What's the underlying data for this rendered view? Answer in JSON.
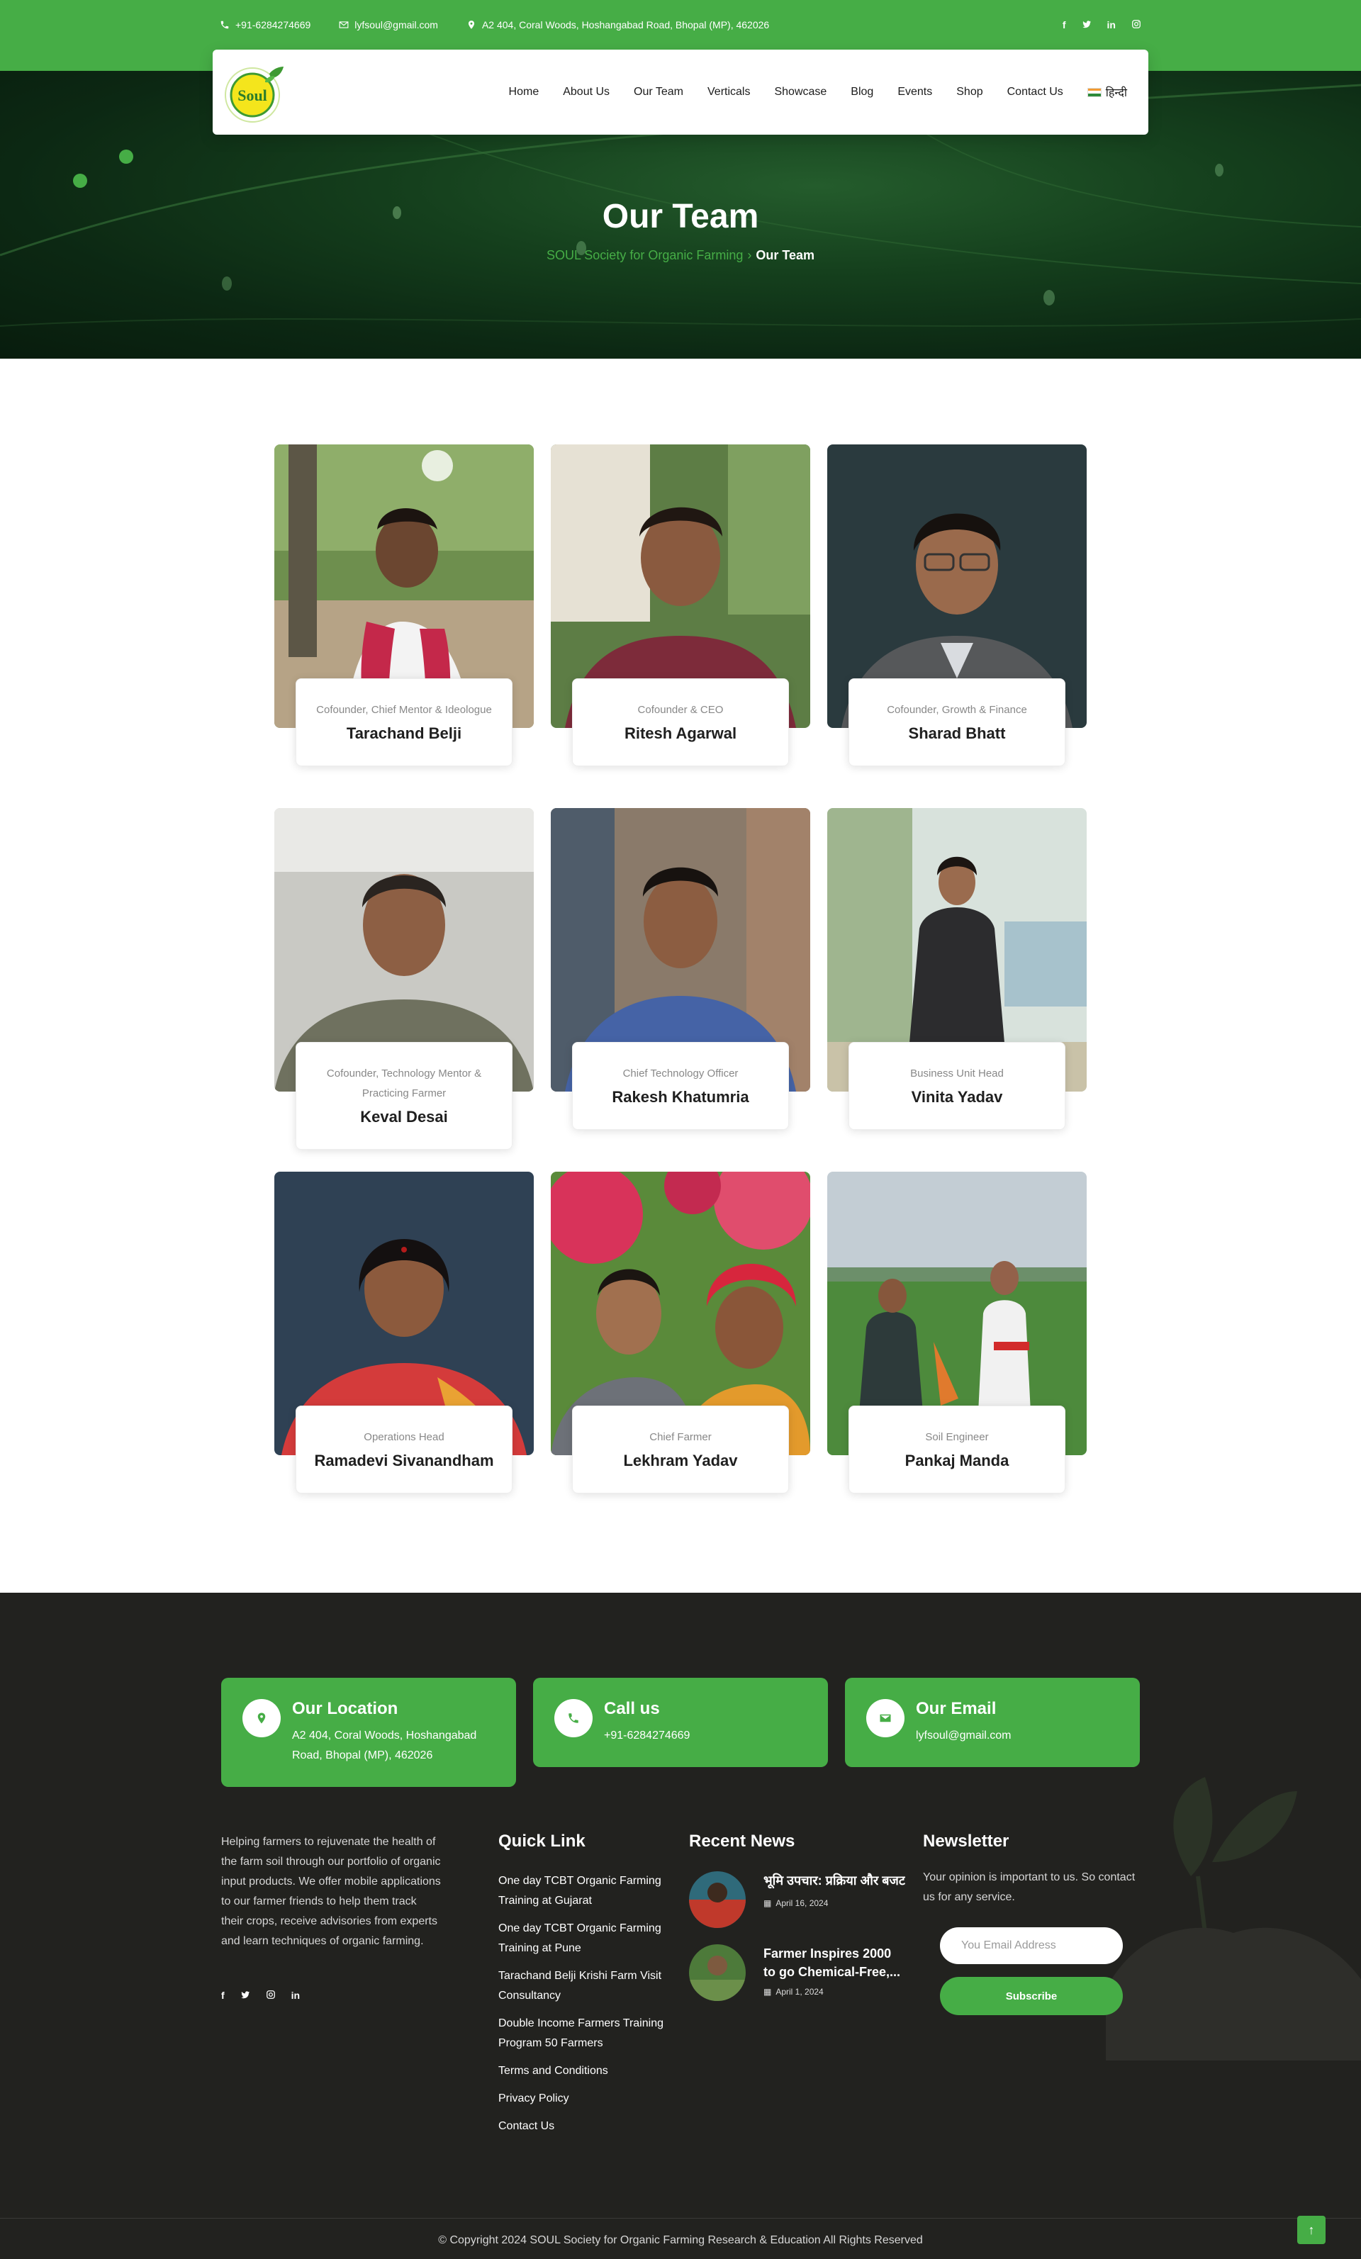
{
  "topbar": {
    "phone": "+91-6284274669",
    "email": "lyfsoul@gmail.com",
    "address": "A2 404, Coral Woods, Hoshangabad Road, Bhopal (MP), 462026",
    "socials": [
      "f",
      "t",
      "in",
      "ig"
    ]
  },
  "nav": {
    "logo_text": "Soul",
    "items": [
      "Home",
      "About Us",
      "Our Team",
      "Verticals",
      "Showcase",
      "Blog",
      "Events",
      "Shop",
      "Contact Us"
    ],
    "language": "हिन्दी"
  },
  "hero": {
    "title": "Our Team",
    "breadcrumb_home": "SOUL Society for Organic Farming",
    "breadcrumb_current": "Our Team"
  },
  "team": [
    {
      "role": "Cofounder, Chief Mentor & Ideologue",
      "name": "Tarachand Belji"
    },
    {
      "role": "Cofounder & CEO",
      "name": "Ritesh Agarwal"
    },
    {
      "role": "Cofounder, Growth & Finance",
      "name": "Sharad Bhatt"
    },
    {
      "role": "Cofounder, Technology Mentor & Practicing Farmer",
      "name": "Keval Desai"
    },
    {
      "role": "Chief Technology Officer",
      "name": "Rakesh Khatumria"
    },
    {
      "role": "Business Unit Head",
      "name": "Vinita Yadav"
    },
    {
      "role": "Operations Head",
      "name": "Ramadevi Sivanandham"
    },
    {
      "role": "Chief Farmer",
      "name": "Lekhram Yadav"
    },
    {
      "role": "Soil Engineer",
      "name": "Pankaj Manda"
    }
  ],
  "footer": {
    "location": {
      "title": "Our Location",
      "text": "A2 404, Coral Woods, Hoshangabad Road, Bhopal (MP), 462026"
    },
    "call": {
      "title": "Call us",
      "text": "+91-6284274669"
    },
    "email": {
      "title": "Our Email",
      "text": "lyfsoul@gmail.com"
    },
    "about": "Helping farmers to rejuvenate the health of the farm soil through our portfolio of organic input products. We offer mobile applications to our farmer friends to help them track their crops, receive advisories from experts and learn techniques of organic farming.",
    "quick_link_title": "Quick Link",
    "quick_links": [
      "One day TCBT Organic Farming Training at Gujarat",
      "One day TCBT Organic Farming Training at Pune",
      "Tarachand Belji Krishi Farm Visit Consultancy",
      "Double Income Farmers Training Program 50 Farmers",
      "Terms and Conditions",
      "Privacy Policy",
      "Contact Us"
    ],
    "recent_news_title": "Recent News",
    "news": [
      {
        "title": "भूमि उपचार: प्रक्रिया और बजट",
        "date": "April 16, 2024"
      },
      {
        "title": "Farmer Inspires 2000 to go Chemical-Free,...",
        "date": "April 1, 2024"
      }
    ],
    "newsletter_title": "Newsletter",
    "newsletter_text": "Your opinion is important to us. So contact us for any service.",
    "newsletter_placeholder": "You Email Address",
    "subscribe_label": "Subscribe",
    "copyright": "© Copyright 2024 SOUL Society for Organic Farming Research & Education All Rights Reserved",
    "to_top": "↑"
  },
  "colors": {
    "brand_green": "#46ad46",
    "footer_bg": "#22221f"
  }
}
